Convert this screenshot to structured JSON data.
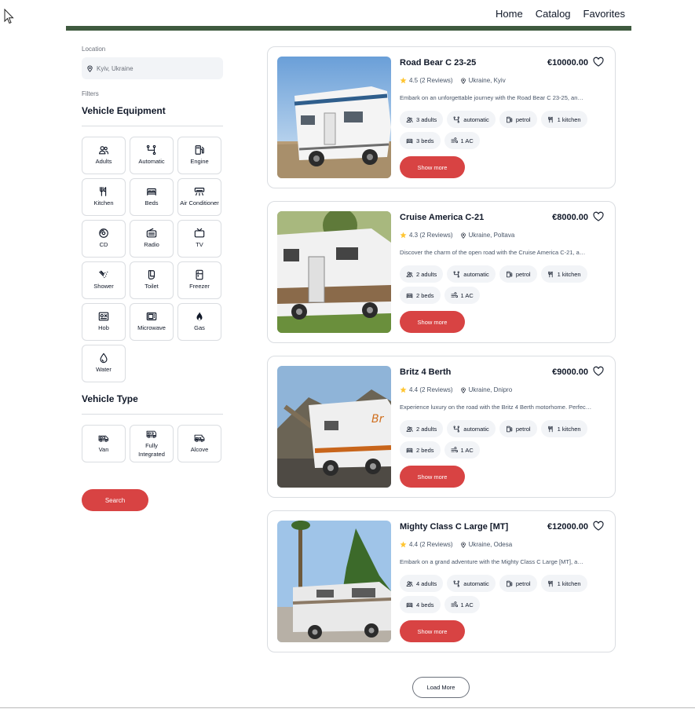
{
  "nav": {
    "home": "Home",
    "catalog": "Catalog",
    "favorites": "Favorites"
  },
  "sidebar": {
    "location_label": "Location",
    "location_value": "Kyiv, Ukraine",
    "filters_label": "Filters",
    "equipment_title": "Vehicle Equipment",
    "equipment": [
      {
        "label": "Adults",
        "icon": "adults-icon"
      },
      {
        "label": "Automatic",
        "icon": "automatic-icon"
      },
      {
        "label": "Engine",
        "icon": "engine-icon"
      },
      {
        "label": "Kitchen",
        "icon": "kitchen-icon"
      },
      {
        "label": "Beds",
        "icon": "beds-icon"
      },
      {
        "label": "Air Conditioner",
        "icon": "air-conditioner-icon"
      },
      {
        "label": "CD",
        "icon": "cd-icon"
      },
      {
        "label": "Radio",
        "icon": "radio-icon"
      },
      {
        "label": "TV",
        "icon": "tv-icon"
      },
      {
        "label": "Shower",
        "icon": "shower-icon"
      },
      {
        "label": "Toilet",
        "icon": "toilet-icon"
      },
      {
        "label": "Freezer",
        "icon": "freezer-icon"
      },
      {
        "label": "Hob",
        "icon": "hob-icon"
      },
      {
        "label": "Microwave",
        "icon": "microwave-icon"
      },
      {
        "label": "Gas",
        "icon": "gas-icon"
      },
      {
        "label": "Water",
        "icon": "water-icon"
      }
    ],
    "type_title": "Vehicle Type",
    "types": [
      {
        "label": "Van",
        "icon": "van-icon"
      },
      {
        "label": "Fully Integrated",
        "icon": "fully-integrated-icon"
      },
      {
        "label": "Alcove",
        "icon": "alcove-icon"
      }
    ],
    "search_label": "Search"
  },
  "cards": [
    {
      "name": "Road Bear C 23-25",
      "price": "€10000.00",
      "rating": "4.5 (2 Reviews)",
      "location": "Ukraine, Kyiv",
      "description": "Embark on an unforgettable journey with the Road Bear C 23-25, an…",
      "chips": [
        "3 adults",
        "automatic",
        "petrol",
        "1 kitchen",
        "3 beds",
        "1 AC"
      ],
      "button": "Show more"
    },
    {
      "name": "Cruise America C-21",
      "price": "€8000.00",
      "rating": "4.3 (2 Reviews)",
      "location": "Ukraine, Poltava",
      "description": "Discover the charm of the open road with the Cruise America C-21, a…",
      "chips": [
        "2 adults",
        "automatic",
        "petrol",
        "1 kitchen",
        "2 beds",
        "1 AC"
      ],
      "button": "Show more"
    },
    {
      "name": "Britz 4 Berth",
      "price": "€9000.00",
      "rating": "4.4 (2 Reviews)",
      "location": "Ukraine, Dnipro",
      "description": "Experience luxury on the road with the Britz 4 Berth motorhome. Perfec…",
      "chips": [
        "2 adults",
        "automatic",
        "petrol",
        "1 kitchen",
        "2 beds",
        "1 AC"
      ],
      "button": "Show more"
    },
    {
      "name": "Mighty Class C Large [MT]",
      "price": "€12000.00",
      "rating": "4.4 (2 Reviews)",
      "location": "Ukraine, Odesa",
      "description": "Embark on a grand adventure with the Mighty Class C Large [MT], a…",
      "chips": [
        "4 adults",
        "automatic",
        "petrol",
        "1 kitchen",
        "4 beds",
        "1 AC"
      ],
      "button": "Show more"
    }
  ],
  "load_more": "Load More",
  "colors": {
    "accent": "#d84343",
    "nav_bar": "#3f5a3f",
    "chip_bg": "#f2f4f7",
    "star": "#ffc531"
  }
}
